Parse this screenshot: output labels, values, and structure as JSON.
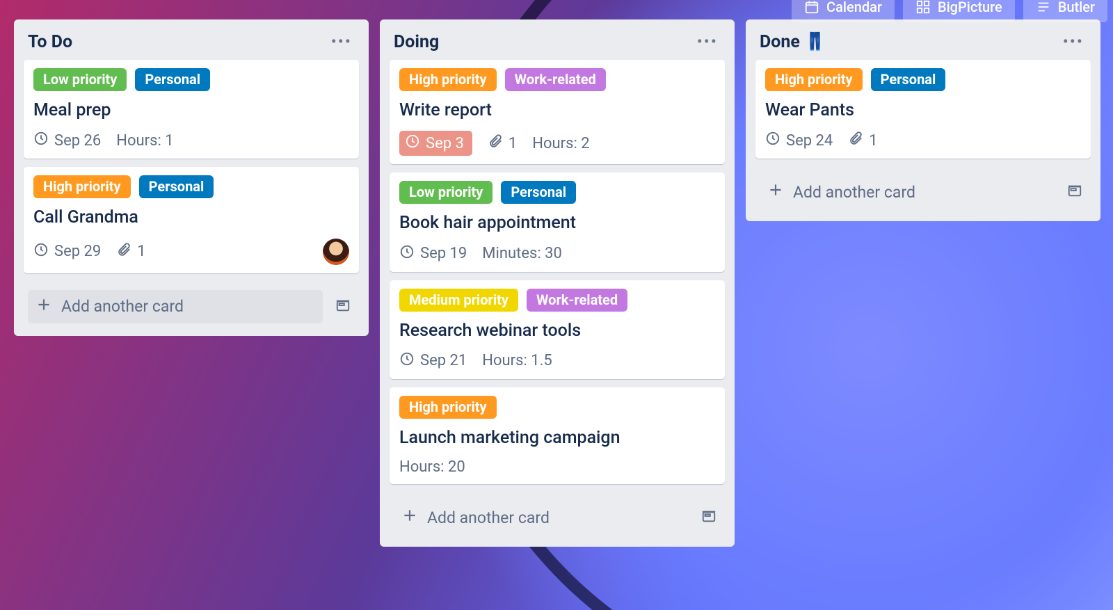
{
  "topbar": {
    "calendar": "Calendar",
    "bigpicture": "BigPicture",
    "butler": "Butler"
  },
  "lists": [
    {
      "title": "To Do",
      "add_label": "Add another card",
      "add_solid": true,
      "cards": [
        {
          "labels": [
            {
              "text": "Low priority",
              "color": "low"
            },
            {
              "text": "Personal",
              "color": "personal"
            }
          ],
          "title": "Meal prep",
          "due": "Sep 26",
          "due_overdue": false,
          "attachments": null,
          "extra": "Hours: 1",
          "avatar": false
        },
        {
          "labels": [
            {
              "text": "High priority",
              "color": "high"
            },
            {
              "text": "Personal",
              "color": "personal"
            }
          ],
          "title": "Call Grandma",
          "due": "Sep 29",
          "due_overdue": false,
          "attachments": "1",
          "extra": null,
          "avatar": true
        }
      ]
    },
    {
      "title": "Doing",
      "add_label": "Add another card",
      "add_solid": false,
      "cards": [
        {
          "labels": [
            {
              "text": "High priority",
              "color": "high"
            },
            {
              "text": "Work-related",
              "color": "work"
            }
          ],
          "title": "Write report",
          "due": "Sep 3",
          "due_overdue": true,
          "attachments": "1",
          "extra": "Hours: 2",
          "avatar": false
        },
        {
          "labels": [
            {
              "text": "Low priority",
              "color": "low"
            },
            {
              "text": "Personal",
              "color": "personal"
            }
          ],
          "title": "Book hair appointment",
          "due": "Sep 19",
          "due_overdue": false,
          "attachments": null,
          "extra": "Minutes: 30",
          "avatar": false
        },
        {
          "labels": [
            {
              "text": "Medium priority",
              "color": "medium"
            },
            {
              "text": "Work-related",
              "color": "work"
            }
          ],
          "title": "Research webinar tools",
          "due": "Sep 21",
          "due_overdue": false,
          "attachments": null,
          "extra": "Hours: 1.5",
          "avatar": false
        },
        {
          "labels": [
            {
              "text": "High priority",
              "color": "high"
            }
          ],
          "title": "Launch marketing campaign",
          "due": null,
          "due_overdue": false,
          "attachments": null,
          "extra": "Hours: 20",
          "avatar": false
        }
      ]
    },
    {
      "title": "Done 👖",
      "add_label": "Add another card",
      "add_solid": false,
      "cards": [
        {
          "labels": [
            {
              "text": "High priority",
              "color": "high"
            },
            {
              "text": "Personal",
              "color": "personal"
            }
          ],
          "title": "Wear Pants",
          "due": "Sep 24",
          "due_overdue": false,
          "attachments": "1",
          "extra": null,
          "avatar": false
        }
      ]
    }
  ]
}
